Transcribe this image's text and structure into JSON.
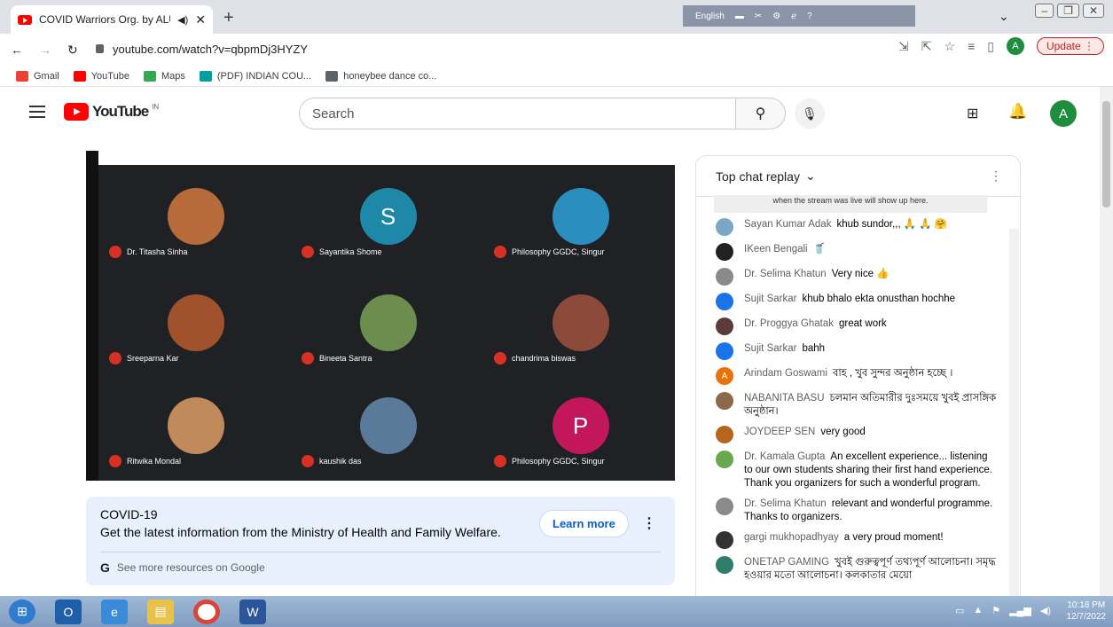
{
  "browser": {
    "tab_title": "COVID Warriors Org. by ALU",
    "tab_audio": "◀)",
    "tab_close": "✕",
    "new_tab": "+",
    "lang_label": "English",
    "url": "youtube.com/watch?v=qbpmDj3HYZY",
    "update_label": "Update",
    "profile_initial": "A"
  },
  "bookmarks": [
    {
      "label": "Gmail",
      "color": "#ea4335"
    },
    {
      "label": "YouTube",
      "color": "#ff0000"
    },
    {
      "label": "Maps",
      "color": "#34a853"
    },
    {
      "label": "(PDF) INDIAN COU...",
      "color": "#00a0a0"
    },
    {
      "label": "honeybee dance co...",
      "color": "#5f6368"
    }
  ],
  "youtube": {
    "logo": "YouTube",
    "country": "IN",
    "search_placeholder": "Search",
    "account_initial": "A"
  },
  "video": {
    "participants": [
      {
        "name": "Dr. Titasha Sinha",
        "color": "#b86b3a"
      },
      {
        "name": "Sayantika Shome",
        "initial": "S",
        "color": "#1e88a8"
      },
      {
        "name": "Philosophy GGDC, Singur",
        "color": "#2a8fbf"
      },
      {
        "name": "Sreeparna Kar",
        "color": "#a0522d"
      },
      {
        "name": "Bineeta Santra",
        "color": "#6b8e4e"
      },
      {
        "name": "chandrima biswas",
        "color": "#8b4a3a"
      },
      {
        "name": "Ritwika Mondal",
        "color": "#c08a5a"
      },
      {
        "name": "kaushik das",
        "color": "#5a7a9a"
      },
      {
        "name": "Philosophy GGDC, Singur",
        "initial": "P",
        "color": "#c2185b"
      }
    ]
  },
  "covid_card": {
    "title": "COVID-19",
    "description": "Get the latest information from the Ministry of Health and Family Welfare.",
    "learn_more": "Learn more",
    "see_more": "See more resources on Google"
  },
  "chat": {
    "header": "Top chat replay",
    "note": "when the stream was live will show up here.",
    "messages": [
      {
        "author": "Sayan Kumar Adak",
        "text": "khub sundor,,, 🙏 🙏 🤗",
        "color": "#7aa7c7"
      },
      {
        "author": "IKeen Bengali",
        "text": "🥤",
        "color": "#222222"
      },
      {
        "author": "Dr. Selima Khatun",
        "text": "Very nice 👍",
        "color": "#8a8a8a"
      },
      {
        "author": "Sujit Sarkar",
        "text": "khub bhalo ekta onusthan hochhe",
        "color": "#1a73e8"
      },
      {
        "author": "Dr. Proggya Ghatak",
        "text": "great work",
        "color": "#5a3a3a"
      },
      {
        "author": "Sujit Sarkar",
        "text": "bahh",
        "color": "#1a73e8"
      },
      {
        "author": "Arindam Goswami",
        "text": "বাহ , খুব সুন্দর অনুষ্ঠান হচ্ছে ।",
        "color": "#e8710a",
        "initial": "A"
      },
      {
        "author": "NABANITA BASU",
        "text": "চলমান অতিমারীর দুঃসময়ে খুবই প্রাসঙ্গিক অনুষ্ঠান।",
        "color": "#8a6a4a"
      },
      {
        "author": "JOYDEEP SEN",
        "text": "very good",
        "color": "#b5651d"
      },
      {
        "author": "Dr. Kamala Gupta",
        "text": "An excellent experience... listening to our own students sharing their first hand experience. Thank you organizers for such a wonderful program.",
        "color": "#6aa84f"
      },
      {
        "author": "Dr. Selima Khatun",
        "text": "relevant and wonderful programme. Thanks to organizers.",
        "color": "#8a8a8a"
      },
      {
        "author": "gargi mukhopadhyay",
        "text": "a very proud moment!",
        "color": "#333333"
      },
      {
        "author": "ONETAP GAMING",
        "text": "খুবই গুরুত্বপূর্ণ তথ্যপূর্ণ আলোচনা। সমৃদ্ধ হওয়ার মতো আলোচনা। কলকাতার মেয়ো",
        "color": "#2e7d6b"
      }
    ]
  },
  "taskbar": {
    "time": "10:18 PM",
    "date": "12/7/2022"
  }
}
